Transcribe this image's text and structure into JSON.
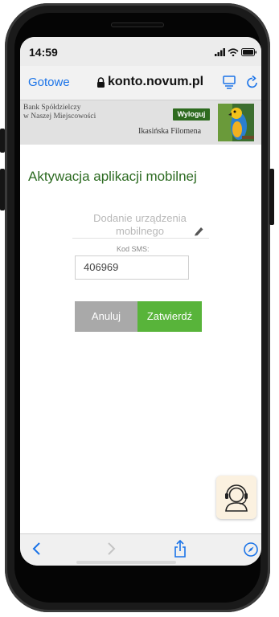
{
  "status_bar": {
    "time": "14:59"
  },
  "browser": {
    "done_label": "Gotowe",
    "url": "konto.novum.pl"
  },
  "bank": {
    "name_line1": "Bank Spółdzielczy",
    "name_line2": "w Naszej Miejscowości",
    "logout_label": "Wyloguj",
    "user_name": "Ikasińska Filomena"
  },
  "main": {
    "title": "Aktywacja aplikacji mobilnej",
    "device_label_line1": "Dodanie urządzenia",
    "device_label_line2": "mobilnego",
    "sms_label": "Kod SMS:",
    "sms_value": "406969",
    "cancel_label": "Anuluj",
    "confirm_label": "Zatwierdź"
  },
  "icons": {
    "lock": "lock-icon",
    "tabs": "tabs-icon",
    "reload": "reload-icon",
    "pencil": "pencil-icon",
    "help": "support-agent-icon",
    "back": "back-icon",
    "forward": "forward-icon",
    "share": "share-icon",
    "compass": "compass-icon"
  },
  "colors": {
    "brand_green": "#2d6b22",
    "logout_bg": "#2e6b1f",
    "confirm_bg": "#58b43a",
    "cancel_bg": "#a9a9a9",
    "link_blue": "#1a73e8"
  }
}
